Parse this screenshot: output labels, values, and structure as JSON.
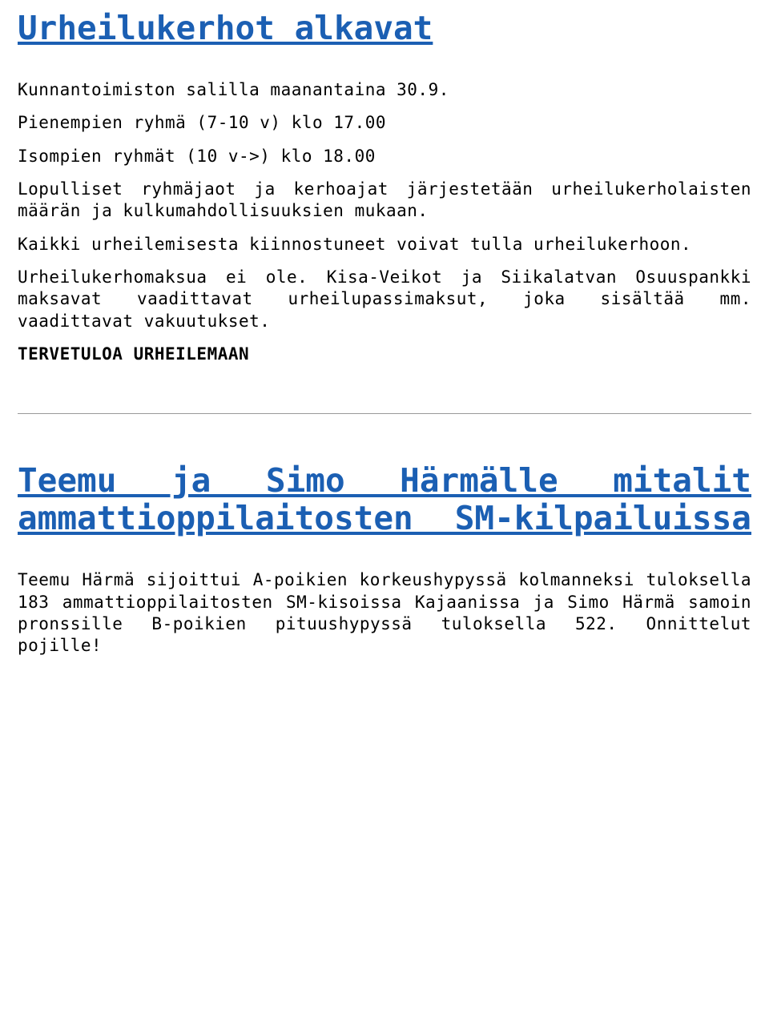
{
  "article1": {
    "title": "Urheilukerhot alkavat",
    "p1": "Kunnantoimiston salilla maanantaina 30.9.",
    "p2": "Pienempien ryhmä (7-10 v) klo 17.00",
    "p3": "Isompien ryhmät (10 v->) klo 18.00",
    "p4": "Lopulliset ryhmäjaot ja kerhoajat järjestetään urheilukerholaisten määrän ja kulkumahdollisuuksien mukaan.",
    "p5": "Kaikki urheilemisesta kiinnostuneet voivat tulla urheilukerhoon.",
    "p6": "Urheilukerhomaksua ei ole. Kisa-Veikot ja Siikalatvan Osuuspankki maksavat vaadittavat urheilupassimaksut, joka sisältää mm. vaadittavat vakuutukset.",
    "p7": "TERVETULOA  URHEILEMAAN"
  },
  "article2": {
    "title": "Teemu ja Simo Härmälle mitalit ammattioppilaitosten SM-kilpailuissa",
    "p1": "Teemu Härmä sijoittui A-poikien korkeushypyssä kolmanneksi tuloksella 183 ammattioppilaitosten SM-kisoissa Kajaanissa ja Simo Härmä samoin pronssille B-poikien pituushypyssä tuloksella 522. Onnittelut pojille!"
  }
}
